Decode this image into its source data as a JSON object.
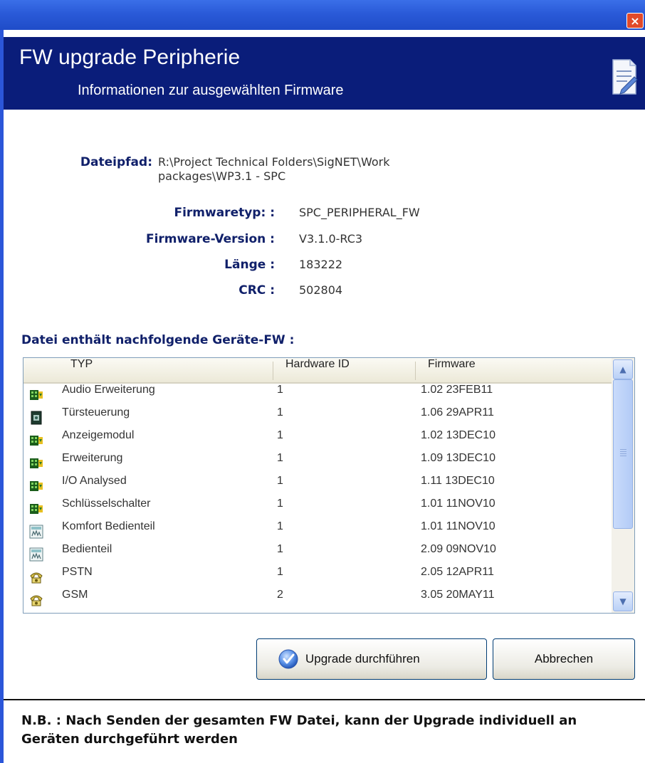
{
  "window": {
    "close_glyph": "×"
  },
  "header": {
    "title": "FW upgrade Peripherie",
    "subtitle": "Informationen zur ausgewählten Firmware",
    "icon": "document-edit-icon"
  },
  "info": {
    "path_label": "Dateipfad:",
    "path_value": "R:\\Project Technical Folders\\SigNET\\Work packages\\WP3.1 - SPC",
    "type_label": "Firmwaretyp: :",
    "type_value": "SPC_PERIPHERAL_FW",
    "version_label": "Firmware-Version :",
    "version_value": "V3.1.0-RC3",
    "length_label": "Länge :",
    "length_value": "183222",
    "crc_label": "CRC :",
    "crc_value": "502804"
  },
  "device_list": {
    "title": "Datei enthält nachfolgende Geräte-FW :",
    "columns": [
      "TYP",
      "Hardware ID",
      "Firmware"
    ],
    "rows": [
      {
        "icon": "expansion-module-icon",
        "type": "Audio Erweiterung",
        "hw": "1",
        "fw": "1.02 23FEB11"
      },
      {
        "icon": "door-controller-icon",
        "type": "Türsteuerung",
        "hw": "1",
        "fw": "1.06 29APR11"
      },
      {
        "icon": "expansion-module-icon",
        "type": "Anzeigemodul",
        "hw": "1",
        "fw": "1.02 13DEC10"
      },
      {
        "icon": "expansion-module-icon",
        "type": "Erweiterung",
        "hw": "1",
        "fw": "1.09 13DEC10"
      },
      {
        "icon": "expansion-module-icon",
        "type": "I/O Analysed",
        "hw": "1",
        "fw": "1.11 13DEC10"
      },
      {
        "icon": "expansion-module-icon",
        "type": "Schlüsselschalter",
        "hw": "1",
        "fw": "1.01 11NOV10"
      },
      {
        "icon": "keypad-icon",
        "type": "Komfort Bedienteil",
        "hw": "1",
        "fw": "1.01 11NOV10"
      },
      {
        "icon": "keypad-icon",
        "type": "Bedienteil",
        "hw": "1",
        "fw": "2.09 09NOV10"
      },
      {
        "icon": "telephone-icon",
        "type": "PSTN",
        "hw": "1",
        "fw": "2.05 12APR11"
      },
      {
        "icon": "telephone-icon",
        "type": "GSM",
        "hw": "2",
        "fw": "3.05 20MAY11"
      }
    ]
  },
  "buttons": {
    "upgrade_label": "Upgrade durchführen",
    "cancel_label": "Abbrechen"
  },
  "note": "N.B. : Nach Senden der gesamten FW Datei, kann der Upgrade individuell an Geräten durchgeführt werden"
}
